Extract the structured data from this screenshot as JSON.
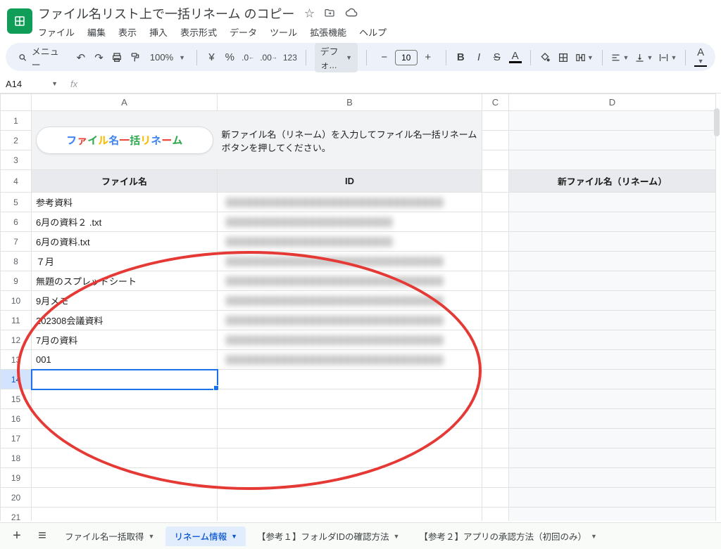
{
  "header": {
    "title": "ファイル名リスト上で一括リネーム のコピー",
    "star_icon": "☆",
    "move_icon": "folder",
    "cloud_icon": "cloud"
  },
  "menubar": [
    "ファイル",
    "編集",
    "表示",
    "挿入",
    "表示形式",
    "データ",
    "ツール",
    "拡張機能",
    "ヘルプ"
  ],
  "toolbar": {
    "search_label": "メニュー",
    "zoom": "100%",
    "font": "デフォ...",
    "font_size": "10"
  },
  "name_box": "A14",
  "columns": [
    "A",
    "B",
    "C",
    "D"
  ],
  "row_numbers": [
    "1",
    "2",
    "3",
    "4",
    "5",
    "6",
    "7",
    "8",
    "9",
    "10",
    "11",
    "12",
    "13",
    "14",
    "15",
    "16",
    "17",
    "18",
    "19",
    "20",
    "21"
  ],
  "rename_button": {
    "chars": [
      "フ",
      "ァ",
      "イ",
      "ル",
      "名",
      "一",
      "括",
      "リ",
      "ネ",
      "ー",
      "ム"
    ]
  },
  "instruction": "新ファイル名（リネーム）を入力してファイル名一括リネームボタンを押してください。",
  "headers": {
    "a": "ファイル名",
    "b": "ID",
    "d": "新ファイル名（リネーム）"
  },
  "files": [
    {
      "name": "参考資料"
    },
    {
      "name": "6月の資料２ .txt"
    },
    {
      "name": "6月の資料.txt"
    },
    {
      "name": "７月"
    },
    {
      "name": "無題のスプレッドシート"
    },
    {
      "name": "9月メモ"
    },
    {
      "name": "202308会議資料"
    },
    {
      "name": "7月の資料"
    },
    {
      "name": "001"
    }
  ],
  "sheet_tabs": [
    {
      "label": "ファイル名一括取得",
      "active": false
    },
    {
      "label": "リネーム情報",
      "active": true
    },
    {
      "label": "【参考１】フォルダIDの確認方法",
      "active": false
    },
    {
      "label": "【参考２】アプリの承認方法（初回のみ）",
      "active": false
    }
  ]
}
